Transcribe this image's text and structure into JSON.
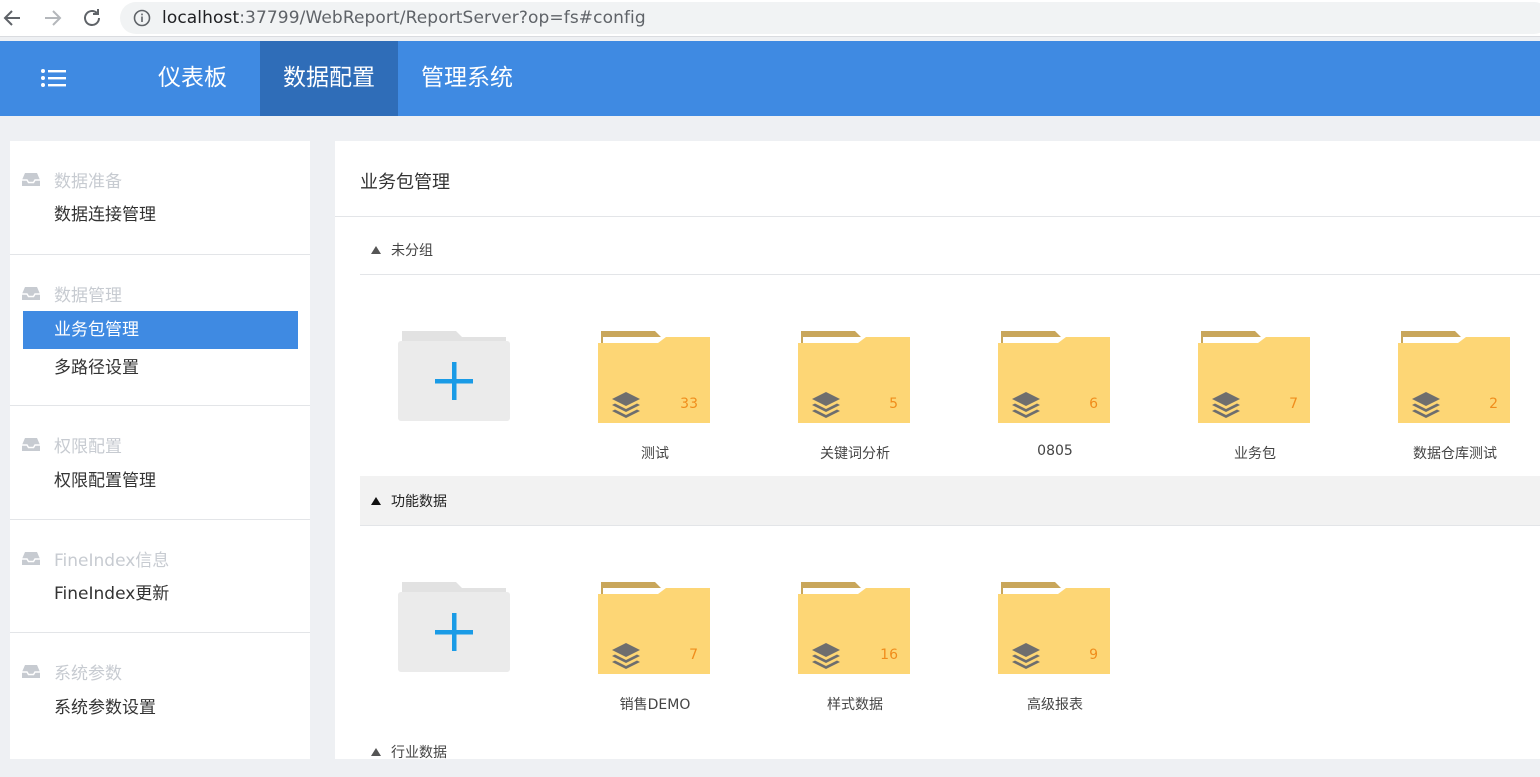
{
  "browser": {
    "url_host": "localhost",
    "url_rest": ":37799/WebReport/ReportServer?op=fs#config"
  },
  "header": {
    "tabs": [
      {
        "label": "仪表板"
      },
      {
        "label": "数据配置"
      },
      {
        "label": "管理系统"
      }
    ],
    "accent_color": "#3f8ae2",
    "active_tab_color": "#2f6db8"
  },
  "sidebar": {
    "groups": [
      {
        "title": "数据准备",
        "items": [
          "数据连接管理"
        ]
      },
      {
        "title": "数据管理",
        "items": [
          "业务包管理",
          "多路径设置"
        ]
      },
      {
        "title": "权限配置",
        "items": [
          "权限配置管理"
        ]
      },
      {
        "title": "FineIndex信息",
        "items": [
          "FineIndex更新"
        ]
      },
      {
        "title": "系统参数",
        "items": [
          "系统参数设置"
        ]
      }
    ],
    "active_item": "业务包管理"
  },
  "main": {
    "title": "业务包管理",
    "groups": [
      {
        "label": "未分组",
        "packages": [
          {
            "name": "测试",
            "count": "33"
          },
          {
            "name": "关键词分析",
            "count": "5"
          },
          {
            "name": "0805",
            "count": "6"
          },
          {
            "name": "业务包",
            "count": "7"
          },
          {
            "name": "数据仓库测试",
            "count": "2"
          }
        ]
      },
      {
        "label": "功能数据",
        "packages": [
          {
            "name": "销售DEMO",
            "count": "7"
          },
          {
            "name": "样式数据",
            "count": "16"
          },
          {
            "name": "高级报表",
            "count": "9"
          }
        ]
      },
      {
        "label": "行业数据",
        "packages": []
      }
    ],
    "folder_color": "#fdd675",
    "add_icon_color": "#1a9be6"
  }
}
